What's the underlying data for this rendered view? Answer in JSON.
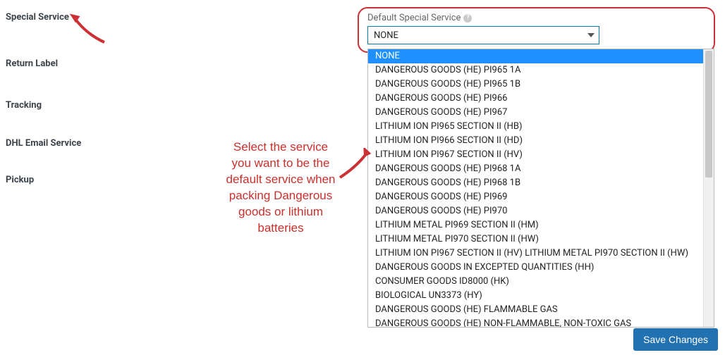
{
  "nav": {
    "special_service": "Special Service",
    "return_label": "Return Label",
    "tracking": "Tracking",
    "dhl_email_service": "DHL Email Service",
    "pickup": "Pickup"
  },
  "field": {
    "label": "Default Special Service",
    "selected": "NONE"
  },
  "options": [
    "NONE",
    "DANGEROUS GOODS (HE) PI965 1A",
    "DANGEROUS GOODS (HE) PI965 1B",
    "DANGEROUS GOODS (HE) PI966",
    "DANGEROUS GOODS (HE) PI967",
    "LITHIUM ION PI965 SECTION II (HB)",
    "LITHIUM ION PI966 SECTION II (HD)",
    "LITHIUM ION PI967 SECTION II (HV)",
    "DANGEROUS GOODS (HE) PI968 1A",
    "DANGEROUS GOODS (HE) PI968 1B",
    "DANGEROUS GOODS (HE) PI969",
    "DANGEROUS GOODS (HE) PI970",
    "LITHIUM METAL PI969 SECTION II (HM)",
    "LITHIUM METAL PI970 SECTION II (HW)",
    "LITHIUM ION PI967 SECTION II (HV) LITHIUM METAL PI970 SECTION II (HW)",
    "DANGEROUS GOODS IN EXCEPTED QUANTITIES (HH)",
    "CONSUMER GOODS ID8000 (HK)",
    "BIOLOGICAL UN3373 (HY)",
    "DANGEROUS GOODS (HE) FLAMMABLE GAS",
    "DANGEROUS GOODS (HE) NON-FLAMMABLE, NON-TOXIC GAS"
  ],
  "annotation": {
    "l1": "Select the service",
    "l2": "you want to be the",
    "l3": "default service when",
    "l4": "packing Dangerous",
    "l5": "goods or lithium",
    "l6": "batteries"
  },
  "buttons": {
    "save_changes": "Save Changes"
  }
}
